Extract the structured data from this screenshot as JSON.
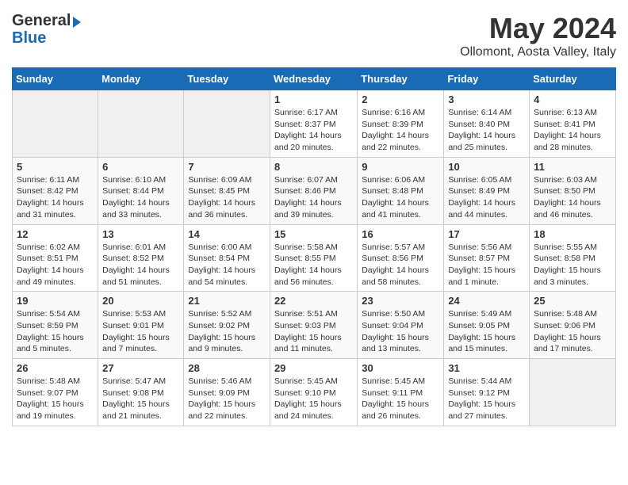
{
  "header": {
    "logo_general": "General",
    "logo_blue": "Blue",
    "title": "May 2024",
    "subtitle": "Ollomont, Aosta Valley, Italy"
  },
  "weekdays": [
    "Sunday",
    "Monday",
    "Tuesday",
    "Wednesday",
    "Thursday",
    "Friday",
    "Saturday"
  ],
  "weeks": [
    [
      {
        "day": "",
        "info": ""
      },
      {
        "day": "",
        "info": ""
      },
      {
        "day": "",
        "info": ""
      },
      {
        "day": "1",
        "info": "Sunrise: 6:17 AM\nSunset: 8:37 PM\nDaylight: 14 hours\nand 20 minutes."
      },
      {
        "day": "2",
        "info": "Sunrise: 6:16 AM\nSunset: 8:39 PM\nDaylight: 14 hours\nand 22 minutes."
      },
      {
        "day": "3",
        "info": "Sunrise: 6:14 AM\nSunset: 8:40 PM\nDaylight: 14 hours\nand 25 minutes."
      },
      {
        "day": "4",
        "info": "Sunrise: 6:13 AM\nSunset: 8:41 PM\nDaylight: 14 hours\nand 28 minutes."
      }
    ],
    [
      {
        "day": "5",
        "info": "Sunrise: 6:11 AM\nSunset: 8:42 PM\nDaylight: 14 hours\nand 31 minutes."
      },
      {
        "day": "6",
        "info": "Sunrise: 6:10 AM\nSunset: 8:44 PM\nDaylight: 14 hours\nand 33 minutes."
      },
      {
        "day": "7",
        "info": "Sunrise: 6:09 AM\nSunset: 8:45 PM\nDaylight: 14 hours\nand 36 minutes."
      },
      {
        "day": "8",
        "info": "Sunrise: 6:07 AM\nSunset: 8:46 PM\nDaylight: 14 hours\nand 39 minutes."
      },
      {
        "day": "9",
        "info": "Sunrise: 6:06 AM\nSunset: 8:48 PM\nDaylight: 14 hours\nand 41 minutes."
      },
      {
        "day": "10",
        "info": "Sunrise: 6:05 AM\nSunset: 8:49 PM\nDaylight: 14 hours\nand 44 minutes."
      },
      {
        "day": "11",
        "info": "Sunrise: 6:03 AM\nSunset: 8:50 PM\nDaylight: 14 hours\nand 46 minutes."
      }
    ],
    [
      {
        "day": "12",
        "info": "Sunrise: 6:02 AM\nSunset: 8:51 PM\nDaylight: 14 hours\nand 49 minutes."
      },
      {
        "day": "13",
        "info": "Sunrise: 6:01 AM\nSunset: 8:52 PM\nDaylight: 14 hours\nand 51 minutes."
      },
      {
        "day": "14",
        "info": "Sunrise: 6:00 AM\nSunset: 8:54 PM\nDaylight: 14 hours\nand 54 minutes."
      },
      {
        "day": "15",
        "info": "Sunrise: 5:58 AM\nSunset: 8:55 PM\nDaylight: 14 hours\nand 56 minutes."
      },
      {
        "day": "16",
        "info": "Sunrise: 5:57 AM\nSunset: 8:56 PM\nDaylight: 14 hours\nand 58 minutes."
      },
      {
        "day": "17",
        "info": "Sunrise: 5:56 AM\nSunset: 8:57 PM\nDaylight: 15 hours\nand 1 minute."
      },
      {
        "day": "18",
        "info": "Sunrise: 5:55 AM\nSunset: 8:58 PM\nDaylight: 15 hours\nand 3 minutes."
      }
    ],
    [
      {
        "day": "19",
        "info": "Sunrise: 5:54 AM\nSunset: 8:59 PM\nDaylight: 15 hours\nand 5 minutes."
      },
      {
        "day": "20",
        "info": "Sunrise: 5:53 AM\nSunset: 9:01 PM\nDaylight: 15 hours\nand 7 minutes."
      },
      {
        "day": "21",
        "info": "Sunrise: 5:52 AM\nSunset: 9:02 PM\nDaylight: 15 hours\nand 9 minutes."
      },
      {
        "day": "22",
        "info": "Sunrise: 5:51 AM\nSunset: 9:03 PM\nDaylight: 15 hours\nand 11 minutes."
      },
      {
        "day": "23",
        "info": "Sunrise: 5:50 AM\nSunset: 9:04 PM\nDaylight: 15 hours\nand 13 minutes."
      },
      {
        "day": "24",
        "info": "Sunrise: 5:49 AM\nSunset: 9:05 PM\nDaylight: 15 hours\nand 15 minutes."
      },
      {
        "day": "25",
        "info": "Sunrise: 5:48 AM\nSunset: 9:06 PM\nDaylight: 15 hours\nand 17 minutes."
      }
    ],
    [
      {
        "day": "26",
        "info": "Sunrise: 5:48 AM\nSunset: 9:07 PM\nDaylight: 15 hours\nand 19 minutes."
      },
      {
        "day": "27",
        "info": "Sunrise: 5:47 AM\nSunset: 9:08 PM\nDaylight: 15 hours\nand 21 minutes."
      },
      {
        "day": "28",
        "info": "Sunrise: 5:46 AM\nSunset: 9:09 PM\nDaylight: 15 hours\nand 22 minutes."
      },
      {
        "day": "29",
        "info": "Sunrise: 5:45 AM\nSunset: 9:10 PM\nDaylight: 15 hours\nand 24 minutes."
      },
      {
        "day": "30",
        "info": "Sunrise: 5:45 AM\nSunset: 9:11 PM\nDaylight: 15 hours\nand 26 minutes."
      },
      {
        "day": "31",
        "info": "Sunrise: 5:44 AM\nSunset: 9:12 PM\nDaylight: 15 hours\nand 27 minutes."
      },
      {
        "day": "",
        "info": ""
      }
    ]
  ]
}
